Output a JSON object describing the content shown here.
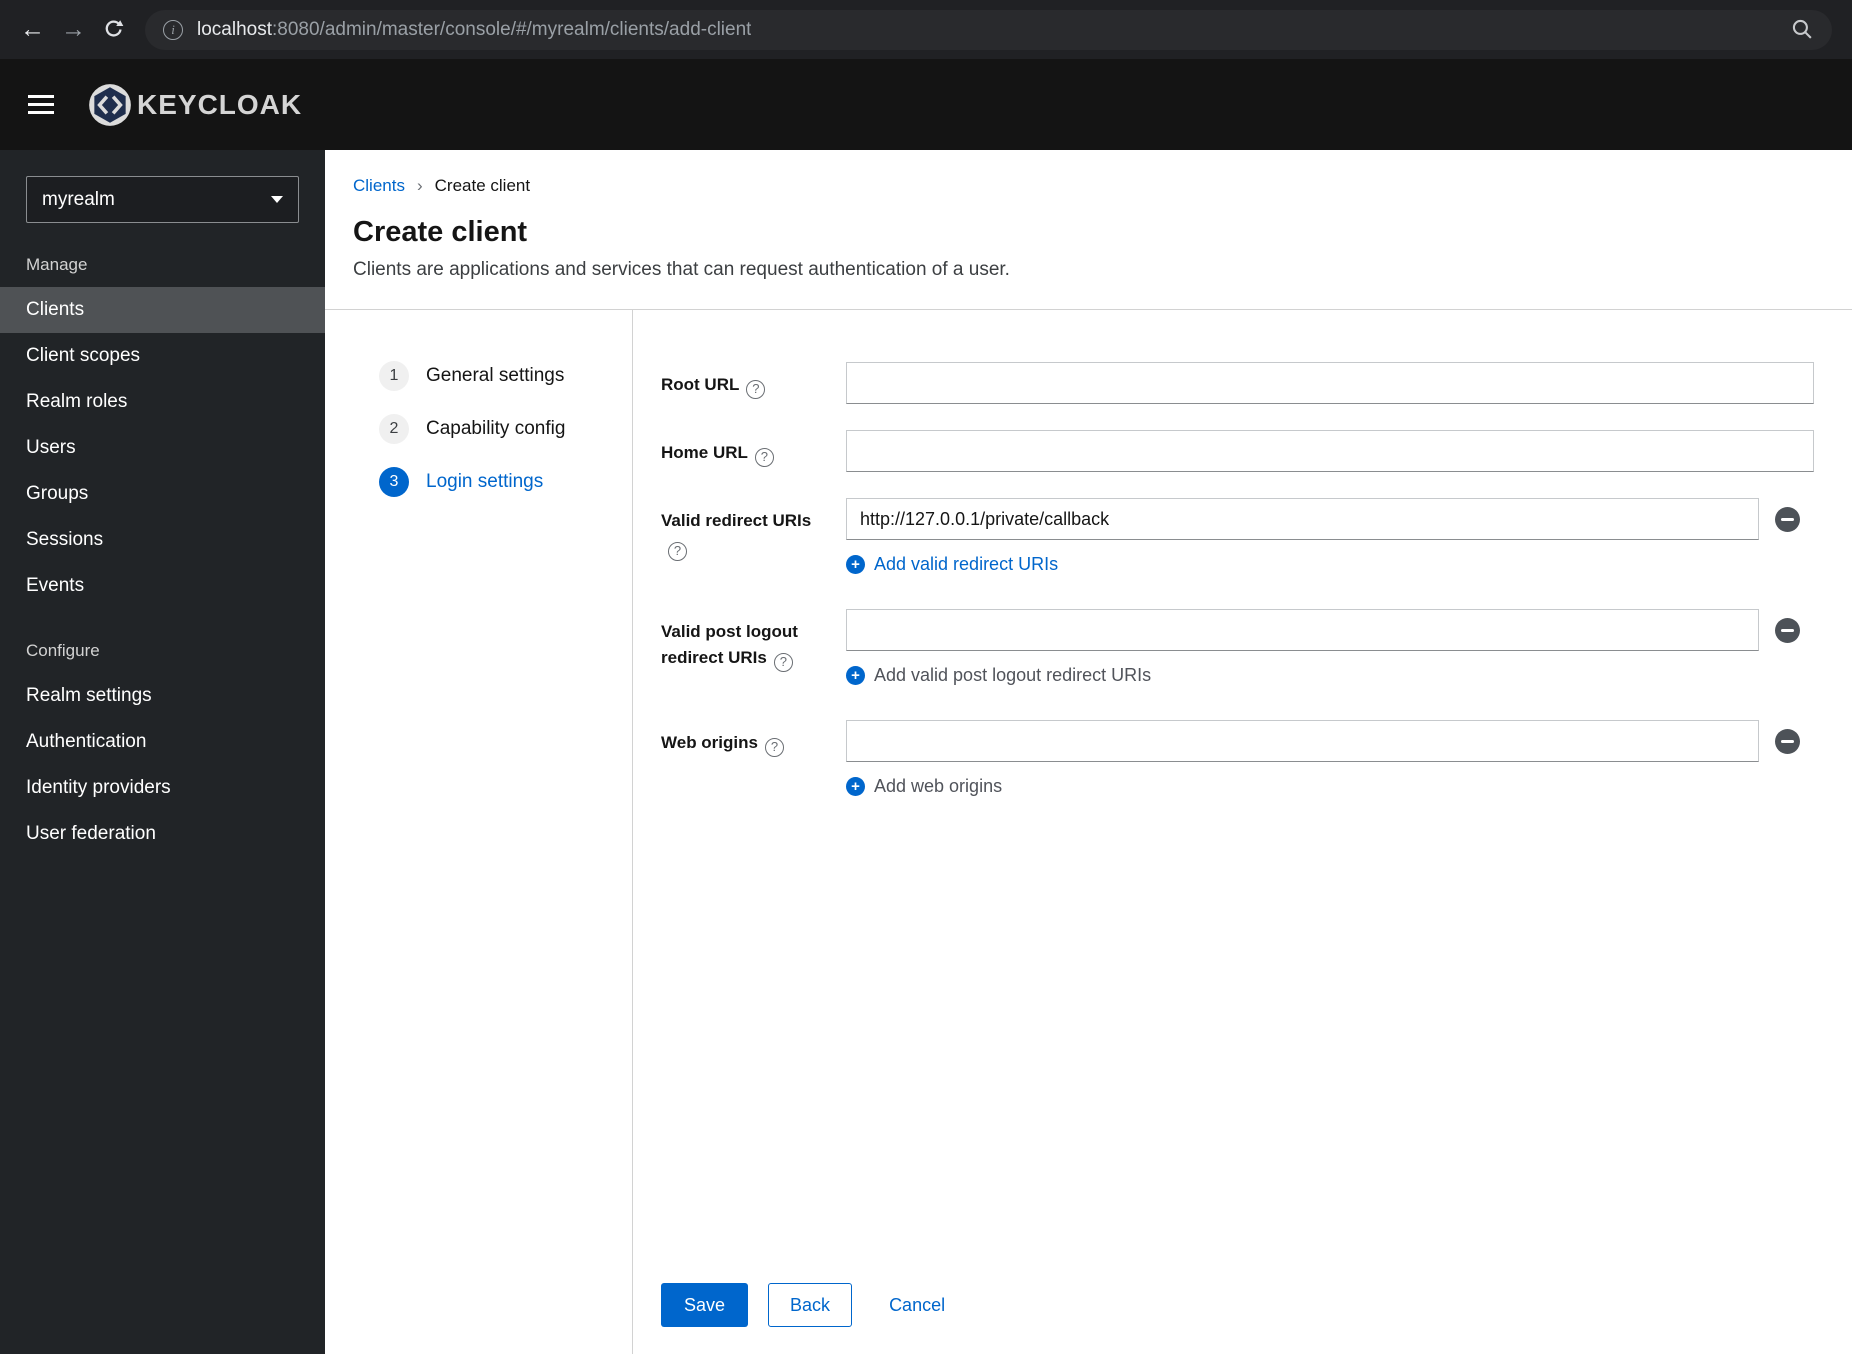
{
  "colors": {
    "primary": "#0066cc",
    "sidebar_bg": "#212427",
    "sidebar_active_bg": "#4f5255",
    "header_bg": "#141414",
    "browser_bar_bg": "#202124"
  },
  "browser": {
    "url_host": "localhost",
    "url_rest": ":8080/admin/master/console/#/myrealm/clients/add-client"
  },
  "header": {
    "logo_text": "KEYCLOAK"
  },
  "sidebar": {
    "realm": "myrealm",
    "active_item": "Clients",
    "sections": [
      {
        "label": "Manage",
        "items": [
          "Clients",
          "Client scopes",
          "Realm roles",
          "Users",
          "Groups",
          "Sessions",
          "Events"
        ]
      },
      {
        "label": "Configure",
        "items": [
          "Realm settings",
          "Authentication",
          "Identity providers",
          "User federation"
        ]
      }
    ]
  },
  "breadcrumb": {
    "link": "Clients",
    "current": "Create client"
  },
  "page": {
    "title": "Create client",
    "subtitle": "Clients are applications and services that can request authentication of a user."
  },
  "wizard": {
    "steps": [
      {
        "num": "1",
        "label": "General settings"
      },
      {
        "num": "2",
        "label": "Capability config"
      },
      {
        "num": "3",
        "label": "Login settings"
      }
    ],
    "active_step": "Login settings"
  },
  "form": {
    "root_url": {
      "label": "Root URL",
      "value": ""
    },
    "home_url": {
      "label": "Home URL",
      "value": ""
    },
    "redirect_uris": {
      "label": "Valid redirect URIs",
      "value": "http://127.0.0.1/private/callback",
      "add_label": "Add valid redirect URIs"
    },
    "post_logout_uris": {
      "label": "Valid post logout redirect URIs",
      "value": "",
      "add_label": "Add valid post logout redirect URIs"
    },
    "web_origins": {
      "label": "Web origins",
      "value": "",
      "add_label": "Add web origins"
    },
    "buttons": {
      "save": "Save",
      "back": "Back",
      "cancel": "Cancel"
    }
  }
}
